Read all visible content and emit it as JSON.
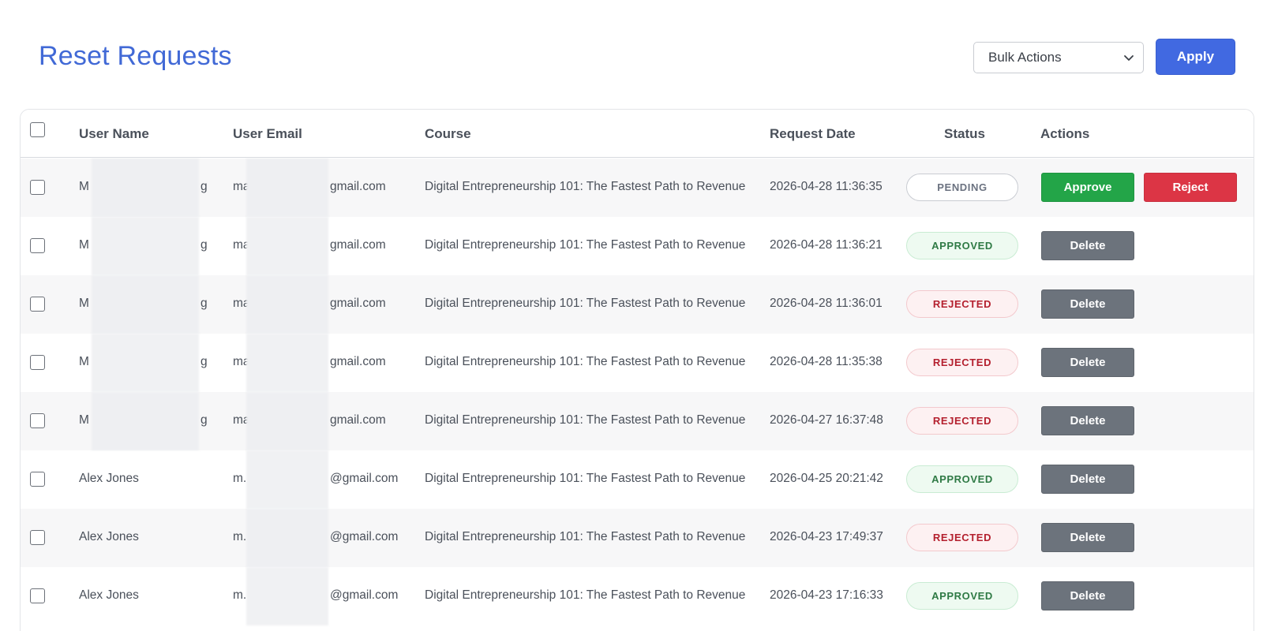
{
  "page": {
    "title": "Reset Requests"
  },
  "toolbar": {
    "bulk_actions": "Bulk Actions",
    "apply": "Apply"
  },
  "table": {
    "headers": {
      "user_name": "User Name",
      "user_email": "User Email",
      "course": "Course",
      "request_date": "Request Date",
      "status": "Status",
      "actions": "Actions"
    },
    "rows": [
      {
        "name": "M",
        "name_end": "g",
        "email": "ma",
        "email_end": "gmail.com",
        "course": "Digital Entrepreneurship 101: The Fastest Path to Revenue",
        "date": "2026-04-28 11:36:35",
        "status": "PENDING",
        "status_kind": "pending",
        "actions": [
          "Approve",
          "Reject"
        ]
      },
      {
        "name": "M",
        "name_end": "g",
        "email": "ma",
        "email_end": "gmail.com",
        "course": "Digital Entrepreneurship 101: The Fastest Path to Revenue",
        "date": "2026-04-28 11:36:21",
        "status": "APPROVED",
        "status_kind": "approved",
        "actions": [
          "Delete"
        ]
      },
      {
        "name": "M",
        "name_end": "g",
        "email": "ma",
        "email_end": "gmail.com",
        "course": "Digital Entrepreneurship 101: The Fastest Path to Revenue",
        "date": "2026-04-28 11:36:01",
        "status": "REJECTED",
        "status_kind": "rejected",
        "actions": [
          "Delete"
        ]
      },
      {
        "name": "M",
        "name_end": "g",
        "email": "ma",
        "email_end": "gmail.com",
        "course": "Digital Entrepreneurship 101: The Fastest Path to Revenue",
        "date": "2026-04-28 11:35:38",
        "status": "REJECTED",
        "status_kind": "rejected",
        "actions": [
          "Delete"
        ]
      },
      {
        "name": "M",
        "name_end": "g",
        "email": "ma",
        "email_end": "gmail.com",
        "course": "Digital Entrepreneurship 101: The Fastest Path to Revenue",
        "date": "2026-04-27 16:37:48",
        "status": "REJECTED",
        "status_kind": "rejected",
        "actions": [
          "Delete"
        ]
      },
      {
        "name": "Alex Jones",
        "name_end": "",
        "email": "m.",
        "email_end": "@gmail.com",
        "course": "Digital Entrepreneurship 101: The Fastest Path to Revenue",
        "date": "2026-04-25 20:21:42",
        "status": "APPROVED",
        "status_kind": "approved",
        "actions": [
          "Delete"
        ]
      },
      {
        "name": "Alex Jones",
        "name_end": "",
        "email": "m.",
        "email_end": "@gmail.com",
        "course": "Digital Entrepreneurship 101: The Fastest Path to Revenue",
        "date": "2026-04-23 17:49:37",
        "status": "REJECTED",
        "status_kind": "rejected",
        "actions": [
          "Delete"
        ]
      },
      {
        "name": "Alex Jones",
        "name_end": "",
        "email": "m.",
        "email_end": "@gmail.com",
        "course": "Digital Entrepreneurship 101: The Fastest Path to Revenue",
        "date": "2026-04-23 17:16:33",
        "status": "APPROVED",
        "status_kind": "approved",
        "actions": [
          "Delete"
        ]
      }
    ]
  }
}
